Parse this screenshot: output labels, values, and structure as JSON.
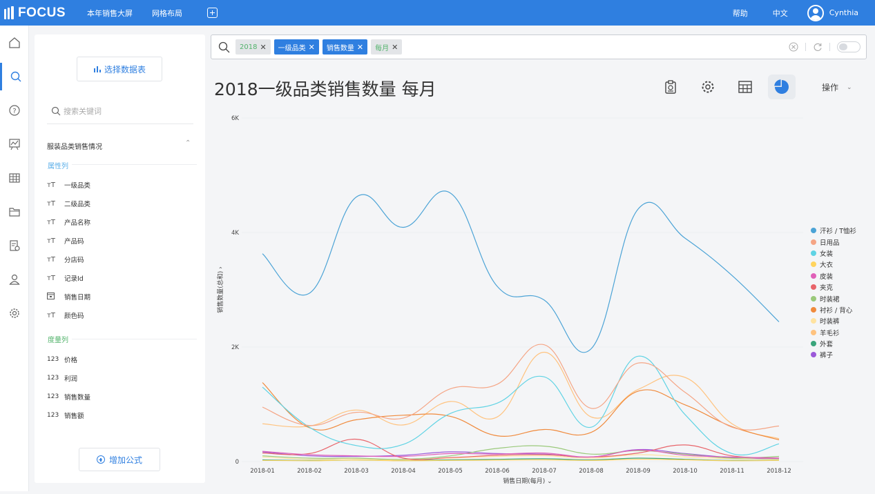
{
  "topbar": {
    "logo_text": "FOCUS",
    "nav": [
      "本年销售大屏",
      "网格布局"
    ],
    "help": "帮助",
    "lang": "中文",
    "user": "Cynthia"
  },
  "sidebar": {
    "pick_table": "选择数据表",
    "search_placeholder": "搜索关键词",
    "dataset": "服装品类销售情况",
    "attr_group": "属性列",
    "attributes": [
      {
        "label": "一级品类",
        "icon": "text-field-icon"
      },
      {
        "label": "二级品类",
        "icon": "text-field-icon"
      },
      {
        "label": "产品名称",
        "icon": "text-field-icon"
      },
      {
        "label": "产品码",
        "icon": "text-field-icon"
      },
      {
        "label": "分店码",
        "icon": "text-field-icon"
      },
      {
        "label": "记录Id",
        "icon": "text-field-icon"
      },
      {
        "label": "销售日期",
        "icon": "calendar-icon"
      },
      {
        "label": "颜色码",
        "icon": "text-field-icon"
      }
    ],
    "measure_group": "度量列",
    "measures": [
      {
        "label": "价格",
        "icon_text": "123"
      },
      {
        "label": "利润",
        "icon_text": "123"
      },
      {
        "label": "销售数量",
        "icon_text": "123"
      },
      {
        "label": "销售额",
        "icon_text": "123"
      }
    ],
    "add_formula": "增加公式"
  },
  "search": {
    "tokens": [
      {
        "label": "2018",
        "style": "gray-green"
      },
      {
        "label": "一级品类",
        "style": "blue"
      },
      {
        "label": "销售数量",
        "style": "blue"
      },
      {
        "label": "每月",
        "style": "gray-green"
      }
    ]
  },
  "main": {
    "title": "2018一级品类销售数量 每月",
    "ops": "操作"
  },
  "colors": {
    "brand": "#2f7fe0",
    "token_green_text": "#52b36b"
  },
  "chart_data": {
    "type": "line",
    "smooth": true,
    "x": [
      "2018-01",
      "2018-02",
      "2018-03",
      "2018-04",
      "2018-05",
      "2018-06",
      "2018-07",
      "2018-08",
      "2018-09",
      "2018-10",
      "2018-11",
      "2018-12"
    ],
    "xlabel": "销售日期(每月)",
    "ylabel": "销售数量(总和)",
    "ylim": [
      0,
      6000
    ],
    "yticks": [
      0,
      2000,
      4000,
      6000
    ],
    "ytick_labels": [
      "0",
      "2K",
      "4K",
      "6K"
    ],
    "grid": true,
    "legend_position": "right",
    "series": [
      {
        "name": "汗衫 / T恤衫",
        "color": "#4ba3d6",
        "values": [
          3630,
          2940,
          4620,
          4090,
          4690,
          3060,
          2820,
          1970,
          4410,
          3900,
          3250,
          2440
        ]
      },
      {
        "name": "日用品",
        "color": "#f5a585",
        "values": [
          950,
          630,
          860,
          760,
          1270,
          1350,
          2040,
          930,
          1720,
          1210,
          600,
          620
        ]
      },
      {
        "name": "女装",
        "color": "#5fd3e4",
        "values": [
          1300,
          600,
          280,
          300,
          840,
          1020,
          1480,
          600,
          1840,
          820,
          140,
          310
        ]
      },
      {
        "name": "大衣",
        "color": "#ffd45e",
        "values": [
          20,
          15,
          25,
          15,
          20,
          25,
          30,
          20,
          40,
          30,
          15,
          20
        ]
      },
      {
        "name": "皮装",
        "color": "#e060b8",
        "values": [
          180,
          120,
          100,
          90,
          140,
          130,
          150,
          80,
          200,
          110,
          80,
          60
        ]
      },
      {
        "name": "夹克",
        "color": "#e8646a",
        "values": [
          150,
          140,
          390,
          60,
          70,
          110,
          120,
          80,
          150,
          290,
          100,
          60
        ]
      },
      {
        "name": "时装裙",
        "color": "#9ac97a",
        "values": [
          100,
          60,
          60,
          40,
          100,
          230,
          270,
          130,
          190,
          130,
          60,
          90
        ]
      },
      {
        "name": "衬衫 / 背心",
        "color": "#f08a3c",
        "values": [
          1380,
          590,
          730,
          810,
          790,
          450,
          560,
          510,
          1230,
          990,
          610,
          380
        ]
      },
      {
        "name": "时装裤",
        "color": "#ffe3a0",
        "values": [
          80,
          40,
          50,
          30,
          60,
          90,
          100,
          60,
          120,
          80,
          50,
          40
        ]
      },
      {
        "name": "羊毛衫",
        "color": "#ffc37f",
        "values": [
          660,
          620,
          900,
          640,
          1050,
          780,
          1910,
          780,
          1260,
          1470,
          660,
          400
        ]
      },
      {
        "name": "外套",
        "color": "#3aa57c",
        "values": [
          30,
          20,
          25,
          20,
          30,
          40,
          50,
          30,
          60,
          40,
          20,
          25
        ]
      },
      {
        "name": "裤子",
        "color": "#9b59d9",
        "values": [
          170,
          100,
          90,
          110,
          170,
          140,
          130,
          80,
          210,
          140,
          70,
          50
        ]
      }
    ]
  }
}
